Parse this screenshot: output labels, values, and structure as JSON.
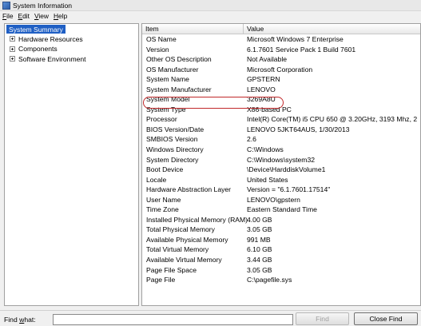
{
  "window": {
    "title": "System Information",
    "icon": "system-information-icon"
  },
  "menu": [
    {
      "key": "file",
      "first": "F",
      "rest": "ile"
    },
    {
      "key": "edit",
      "first": "E",
      "rest": "dit"
    },
    {
      "key": "view",
      "first": "V",
      "rest": "iew"
    },
    {
      "key": "help",
      "first": "H",
      "rest": "elp"
    }
  ],
  "tree": {
    "root": "System Summary",
    "children": [
      "Hardware Resources",
      "Components",
      "Software Environment"
    ]
  },
  "table": {
    "headers": {
      "item": "Item",
      "value": "Value"
    },
    "rows": [
      {
        "item": "OS Name",
        "value": "Microsoft Windows 7 Enterprise"
      },
      {
        "item": "Version",
        "value": "6.1.7601 Service Pack 1 Build 7601"
      },
      {
        "item": "Other OS Description",
        "value": "Not Available"
      },
      {
        "item": "OS Manufacturer",
        "value": "Microsoft Corporation"
      },
      {
        "item": "System Name",
        "value": "GPSTERN"
      },
      {
        "item": "System Manufacturer",
        "value": "LENOVO"
      },
      {
        "item": "System Model",
        "value": "3269A8U"
      },
      {
        "item": "System Type",
        "value": "X86-based PC"
      },
      {
        "item": "Processor",
        "value": "Intel(R) Core(TM) i5 CPU       650  @ 3.20GHz, 3193 Mhz, 2"
      },
      {
        "item": "BIOS Version/Date",
        "value": "LENOVO 5JKT64AUS, 1/30/2013"
      },
      {
        "item": "SMBIOS Version",
        "value": "2.6"
      },
      {
        "item": "Windows Directory",
        "value": "C:\\Windows"
      },
      {
        "item": "System Directory",
        "value": "C:\\Windows\\system32"
      },
      {
        "item": "Boot Device",
        "value": "\\Device\\HarddiskVolume1"
      },
      {
        "item": "Locale",
        "value": "United States"
      },
      {
        "item": "Hardware Abstraction Layer",
        "value": "Version = \"6.1.7601.17514\""
      },
      {
        "item": "User Name",
        "value": "LENOVO\\gpstern"
      },
      {
        "item": "Time Zone",
        "value": "Eastern Standard Time"
      },
      {
        "item": "Installed Physical Memory (RAM)",
        "value": "4.00 GB"
      },
      {
        "item": "Total Physical Memory",
        "value": "3.05 GB"
      },
      {
        "item": "Available Physical Memory",
        "value": "991 MB"
      },
      {
        "item": "Total Virtual Memory",
        "value": "6.10 GB"
      },
      {
        "item": "Available Virtual Memory",
        "value": "3.44 GB"
      },
      {
        "item": "Page File Space",
        "value": "3.05 GB"
      },
      {
        "item": "Page File",
        "value": "C:\\pagefile.sys"
      }
    ]
  },
  "find": {
    "label_first": "Find ",
    "label_underlined": "w",
    "label_rest": "hat:",
    "value": "",
    "find_button": "Find",
    "close_button": "Close Find"
  },
  "colors": {
    "selection": "#1f5fc4",
    "annotation": "#c0282a"
  }
}
